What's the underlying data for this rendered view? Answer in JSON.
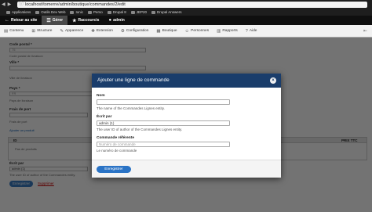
{
  "browser": {
    "url": "localhost/tomerre/admin/boutique/commandes/2/edit",
    "bookmarks": [
      "Applications",
      "Outils Dev Web",
      "Ionic",
      "Perso",
      "Drupal 8",
      "JEP20",
      "Drupal Answers"
    ]
  },
  "toolbar": {
    "items": [
      "Retour au site",
      "Gérer",
      "Raccourcis",
      "admin"
    ]
  },
  "tray": {
    "items": [
      "Contenu",
      "Structure",
      "Apparence",
      "Extension",
      "Configuration",
      "Boutique",
      "Personnes",
      "Rapports",
      "Aide"
    ]
  },
  "background_form": {
    "code_postal_label": "Code postal *",
    "code_postal_value": "75",
    "code_postal_desc": "Code postal de livraison",
    "ville_label": "Ville *",
    "ville_desc": "Ville de livraison",
    "pays_label": "Pays *",
    "pays_value": "FR",
    "pays_desc": "Pays de livraison",
    "frais_label": "Frais de port",
    "frais_desc": "Frais de port",
    "add_product_link": "Ajouter un produit",
    "table_col_id": "ID",
    "table_col_prix": "PRIX TTC",
    "table_empty": "Pas de produits",
    "ecrit_label": "Écrit par",
    "ecrit_value": "admin (1)",
    "ecrit_desc": "The user ID of author of the Commandes entity.",
    "save_label": "Enregistrer",
    "delete_label": "Supprimer"
  },
  "modal": {
    "title": "Ajouter une ligne de commande",
    "nom_label": "Nom",
    "nom_desc": "The name of the Commandes Lignes entity.",
    "ecrit_label": "Écrit par",
    "ecrit_value": "admin (1)",
    "ecrit_desc": "The user ID of author of the Commandes Lignes entity.",
    "commande_label": "Commande référente",
    "commande_placeholder": "Numéro de commande",
    "commande_desc": "Le numéro de commande",
    "submit_label": "Enregistrer"
  },
  "colors": {
    "modal_header": "#1a3d6b",
    "primary_button": "#2a73c5",
    "toolbar_bg": "#0f0f0f"
  }
}
